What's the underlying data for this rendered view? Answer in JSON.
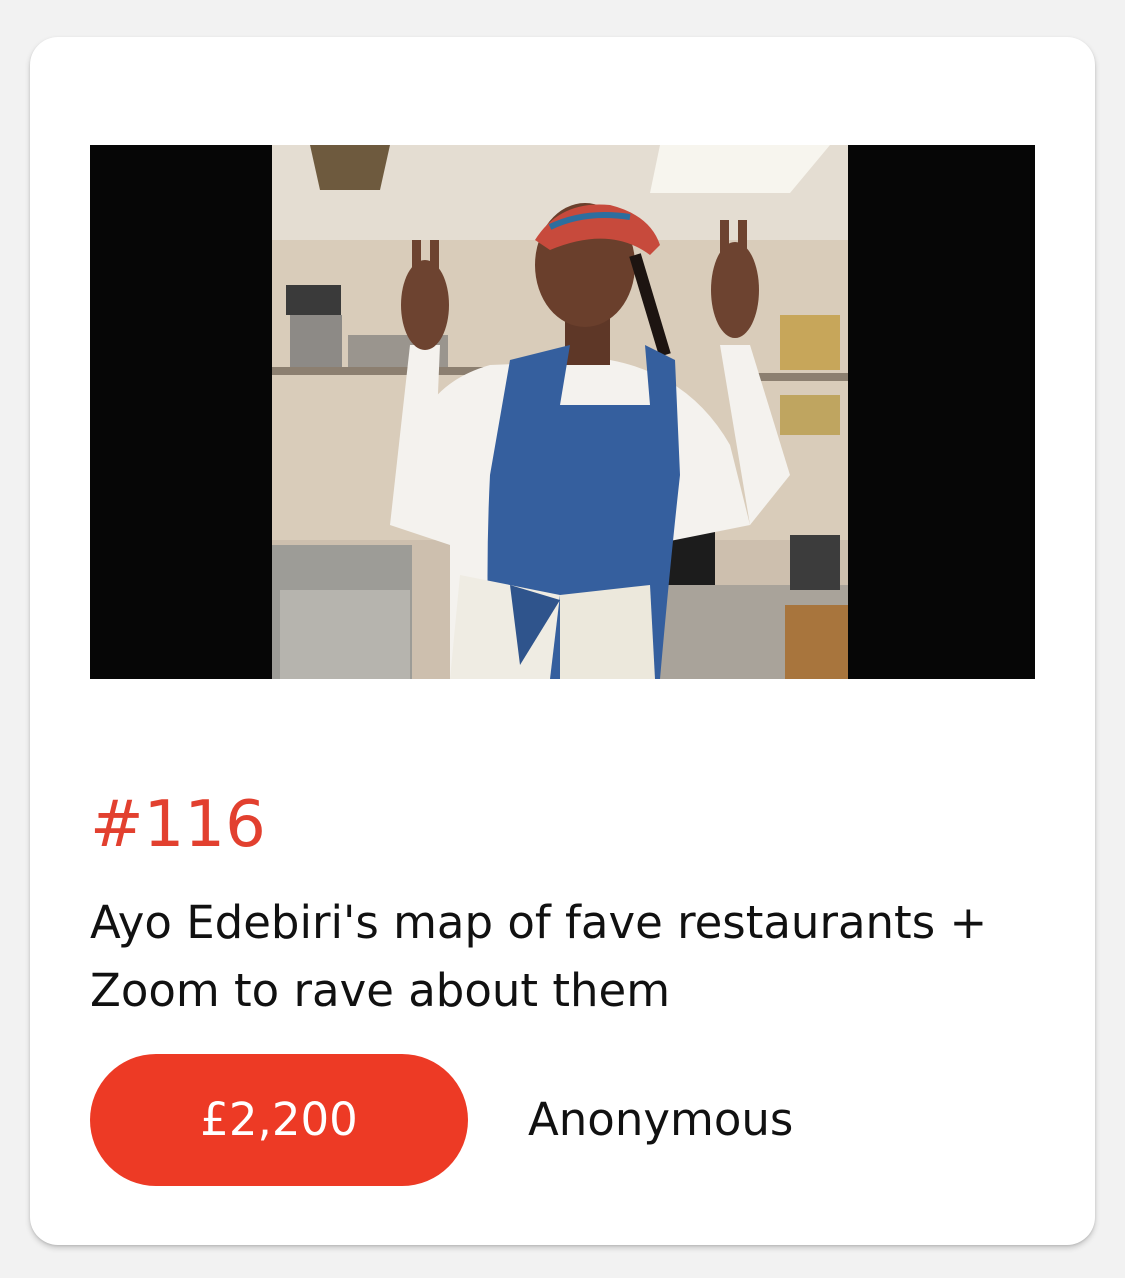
{
  "lot": {
    "number": "#116",
    "title": "Ayo Edebiri's map of fave restaurants + Zoom to rave about them",
    "price": "£2,200",
    "bidder": "Anonymous"
  },
  "image": {
    "alt": "Ayo Edebiri's map of fave restaurants + Zoom to rave about them"
  },
  "colors": {
    "accent": "#e2402f",
    "button": "#ed3a25",
    "card": "#ffffff",
    "background": "#f2f2f2"
  }
}
